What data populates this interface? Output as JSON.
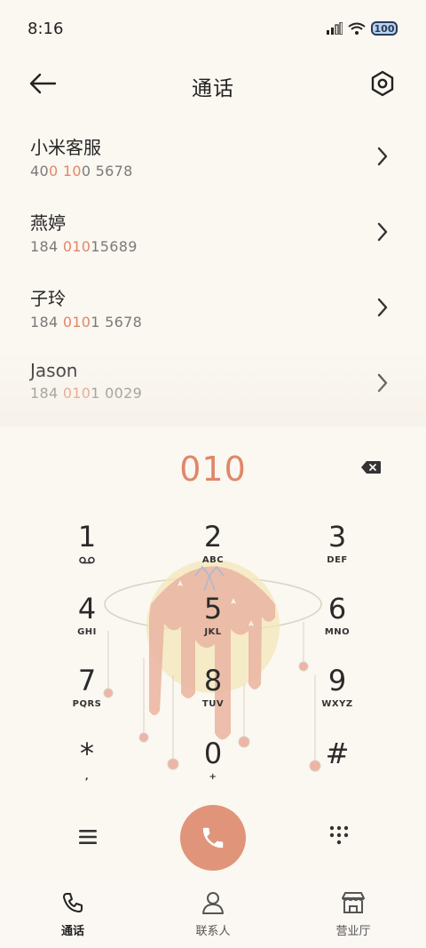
{
  "status_bar": {
    "time": "8:16",
    "battery_level": "100"
  },
  "header": {
    "title": "通话"
  },
  "results": [
    {
      "name": "小米客服",
      "number_parts": [
        "40",
        "0",
        " ",
        "10",
        "0 5678"
      ],
      "highlight_indexes": [
        1,
        3
      ]
    },
    {
      "name": "燕婷",
      "number_parts": [
        "184 ",
        "010",
        "15689"
      ],
      "highlight_indexes": [
        1
      ]
    },
    {
      "name": "子玲",
      "number_parts": [
        "184 ",
        "010",
        "1 5678"
      ],
      "highlight_indexes": [
        1
      ]
    },
    {
      "name": "Jason",
      "number_parts": [
        "184 ",
        "010",
        "1 0029"
      ],
      "highlight_indexes": [
        1
      ]
    }
  ],
  "dialer": {
    "input_value": "010"
  },
  "keypad": [
    {
      "digit": "1",
      "sub": ""
    },
    {
      "digit": "2",
      "sub": "ABC"
    },
    {
      "digit": "3",
      "sub": "DEF"
    },
    {
      "digit": "4",
      "sub": "GHI"
    },
    {
      "digit": "5",
      "sub": "JKL"
    },
    {
      "digit": "6",
      "sub": "MNO"
    },
    {
      "digit": "7",
      "sub": "PQRS"
    },
    {
      "digit": "8",
      "sub": "TUV"
    },
    {
      "digit": "9",
      "sub": "WXYZ"
    },
    {
      "digit": "*",
      "sub": ","
    },
    {
      "digit": "0",
      "sub": "+"
    },
    {
      "digit": "#",
      "sub": ""
    }
  ],
  "bottom_nav": [
    {
      "label": "通话",
      "icon": "phone-icon",
      "active": true
    },
    {
      "label": "联系人",
      "icon": "person-icon",
      "active": false
    },
    {
      "label": "营业厅",
      "icon": "store-icon",
      "active": false
    }
  ],
  "colors": {
    "accent": "#e0876a",
    "call_button": "#e0957a",
    "background": "#fbf7f1"
  }
}
